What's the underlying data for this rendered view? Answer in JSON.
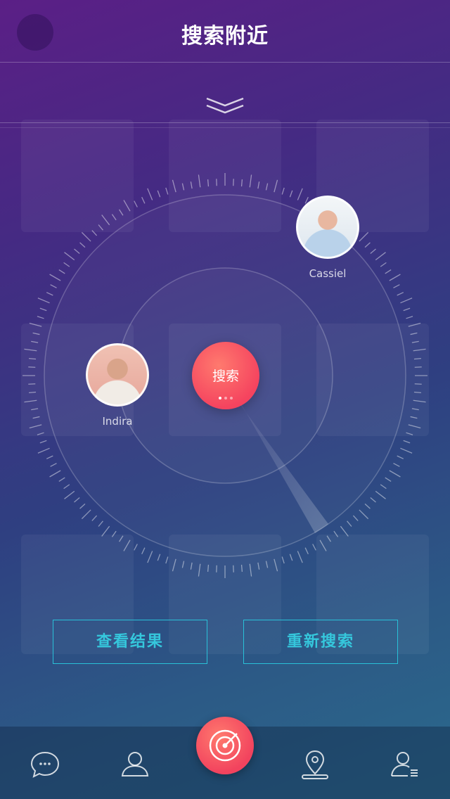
{
  "header": {
    "title": "搜索附近"
  },
  "radar": {
    "center_label": "搜索"
  },
  "people": [
    {
      "name": "Cassiel"
    },
    {
      "name": "Indira"
    }
  ],
  "actions": {
    "view_results": "查看结果",
    "search_again": "重新搜索"
  },
  "tabbar": {
    "items": [
      "chat-icon",
      "contacts-icon",
      "radar-icon",
      "location-icon",
      "profile-list-icon"
    ],
    "active": "radar-icon"
  },
  "colors": {
    "accent": "#35c7dc",
    "primary_red": "#f5445f"
  }
}
